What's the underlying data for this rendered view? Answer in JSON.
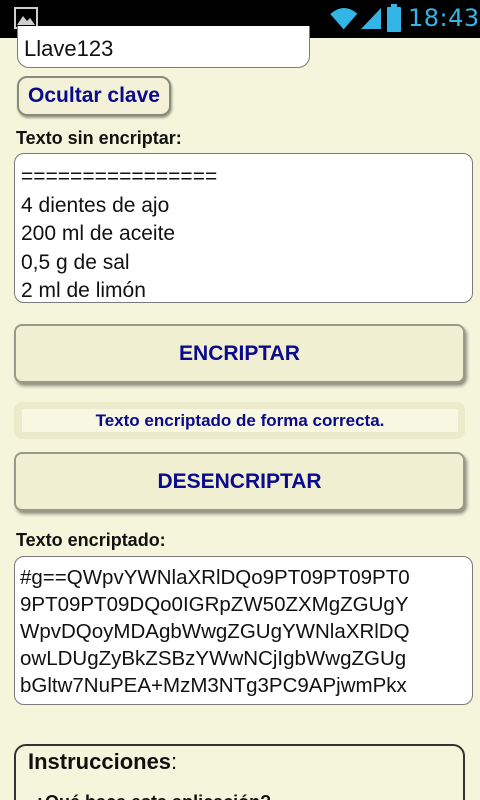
{
  "status_bar": {
    "time": "18:43",
    "icons": [
      "gallery-icon",
      "wifi-icon",
      "signal-icon",
      "battery-icon"
    ],
    "accent_color": "#33b5e5"
  },
  "key_field": {
    "value": "Llave123"
  },
  "hide_key_button": {
    "label": "Ocultar clave"
  },
  "plain_text": {
    "label": "Texto sin encriptar:",
    "lines": [
      "================",
      "4 dientes de ajo",
      "200 ml de aceite",
      "0,5 g de sal",
      "2 ml de limón"
    ]
  },
  "encrypt_button": {
    "label": "ENCRIPTAR"
  },
  "status_message": "Texto encriptado de forma correcta.",
  "decrypt_button": {
    "label": "DESENCRIPTAR"
  },
  "encrypted_text": {
    "label": "Texto encriptado:",
    "lines": [
      "#g==QWpvYWNlaXRlDQo9PT09PT09PT0",
      "9PT09PT09DQo0IGRpZW50ZXMgZGUgY",
      "WpvDQoyMDAgbWwgZGUgYWNlaXRlDQ",
      "owLDUgZyBkZSBzYWwNCjIgbWwgZGUg",
      "bGltw7NuPEA+MzM3NTg3PC9APjwmPkx"
    ]
  },
  "instructions": {
    "title": "Instrucciones",
    "title_suffix": ":",
    "question": "¿Qué hace esta aplicación?"
  },
  "colors": {
    "background": "#f5f5dc",
    "button_text": "#0a0a8c"
  }
}
